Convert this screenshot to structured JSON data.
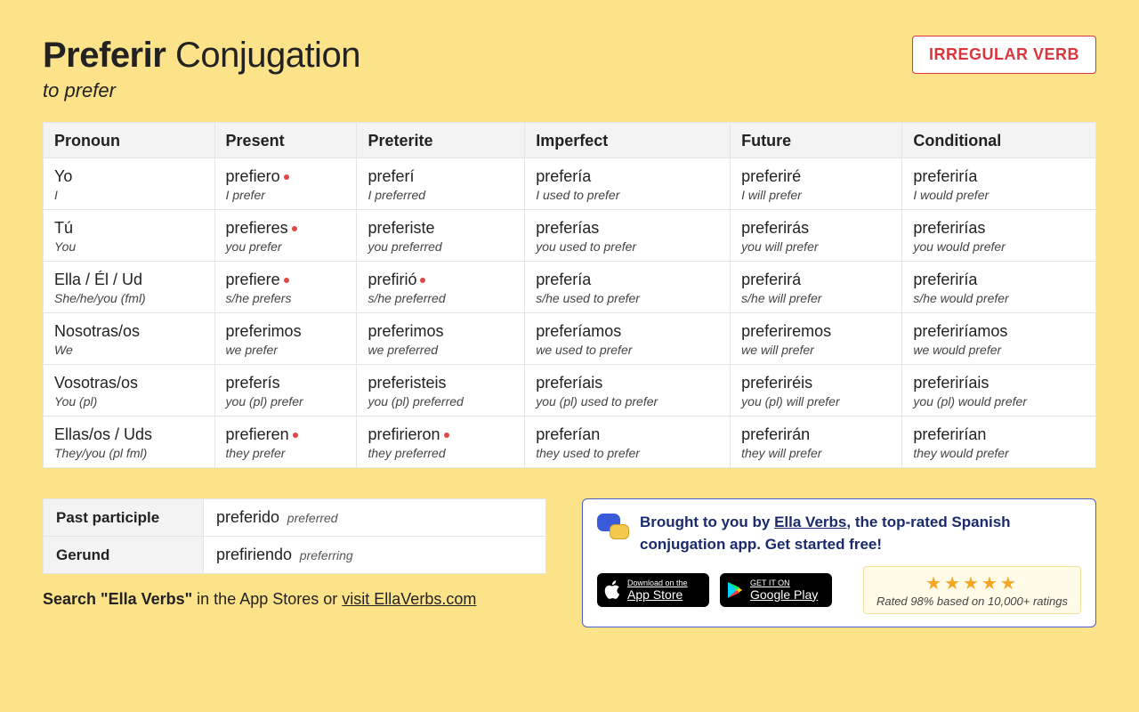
{
  "title_verb": "Preferir",
  "title_rest": "Conjugation",
  "subtitle": "to prefer",
  "badge": "IRREGULAR VERB",
  "headers": [
    "Pronoun",
    "Present",
    "Preterite",
    "Imperfect",
    "Future",
    "Conditional"
  ],
  "rows": [
    {
      "pronoun": {
        "main": "Yo",
        "sub": "I"
      },
      "present": {
        "main": "prefiero",
        "sub": "I prefer",
        "dot": true
      },
      "preterite": {
        "main": "preferí",
        "sub": "I preferred"
      },
      "imperfect": {
        "main": "prefería",
        "sub": "I used to prefer"
      },
      "future": {
        "main": "preferiré",
        "sub": "I will prefer"
      },
      "conditional": {
        "main": "preferiría",
        "sub": "I would prefer"
      }
    },
    {
      "pronoun": {
        "main": "Tú",
        "sub": "You"
      },
      "present": {
        "main": "prefieres",
        "sub": "you prefer",
        "dot": true
      },
      "preterite": {
        "main": "preferiste",
        "sub": "you preferred"
      },
      "imperfect": {
        "main": "preferías",
        "sub": "you used to prefer"
      },
      "future": {
        "main": "preferirás",
        "sub": "you will prefer"
      },
      "conditional": {
        "main": "preferirías",
        "sub": "you would prefer"
      }
    },
    {
      "pronoun": {
        "main": "Ella / Él / Ud",
        "sub": "She/he/you (fml)"
      },
      "present": {
        "main": "prefiere",
        "sub": "s/he prefers",
        "dot": true
      },
      "preterite": {
        "main": "prefirió",
        "sub": "s/he preferred",
        "dot": true
      },
      "imperfect": {
        "main": "prefería",
        "sub": "s/he used to prefer"
      },
      "future": {
        "main": "preferirá",
        "sub": "s/he will prefer"
      },
      "conditional": {
        "main": "preferiría",
        "sub": "s/he would prefer"
      }
    },
    {
      "pronoun": {
        "main": "Nosotras/os",
        "sub": "We"
      },
      "present": {
        "main": "preferimos",
        "sub": "we prefer"
      },
      "preterite": {
        "main": "preferimos",
        "sub": "we preferred"
      },
      "imperfect": {
        "main": "preferíamos",
        "sub": "we used to prefer"
      },
      "future": {
        "main": "preferiremos",
        "sub": "we will prefer"
      },
      "conditional": {
        "main": "preferiríamos",
        "sub": "we would prefer"
      }
    },
    {
      "pronoun": {
        "main": "Vosotras/os",
        "sub": "You (pl)"
      },
      "present": {
        "main": "preferís",
        "sub": "you (pl) prefer"
      },
      "preterite": {
        "main": "preferisteis",
        "sub": "you (pl) preferred"
      },
      "imperfect": {
        "main": "preferíais",
        "sub": "you (pl) used to prefer"
      },
      "future": {
        "main": "preferiréis",
        "sub": "you (pl) will prefer"
      },
      "conditional": {
        "main": "preferiríais",
        "sub": "you (pl) would prefer"
      }
    },
    {
      "pronoun": {
        "main": "Ellas/os / Uds",
        "sub": "They/you (pl fml)"
      },
      "present": {
        "main": "prefieren",
        "sub": "they prefer",
        "dot": true
      },
      "preterite": {
        "main": "prefirieron",
        "sub": "they preferred",
        "dot": true
      },
      "imperfect": {
        "main": "preferían",
        "sub": "they used to prefer"
      },
      "future": {
        "main": "preferirán",
        "sub": "they will prefer"
      },
      "conditional": {
        "main": "preferirían",
        "sub": "they would prefer"
      }
    }
  ],
  "forms": {
    "past_participle": {
      "label": "Past participle",
      "main": "preferido",
      "sub": "preferred"
    },
    "gerund": {
      "label": "Gerund",
      "main": "prefiriendo",
      "sub": "preferring"
    }
  },
  "search_prefix": "Search \"Ella Verbs\"",
  "search_middle": " in the App Stores or ",
  "search_link": "visit EllaVerbs.com",
  "promo": {
    "prefix": "Brought to you by ",
    "brand": "Ella Verbs",
    "suffix": ", the top-rated Spanish conjugation app. Get started free!",
    "appstore_small": "Download on the",
    "appstore_big": "App Store",
    "play_small": "GET IT ON",
    "play_big": "Google Play",
    "rating_text": "Rated 98% based on 10,000+ ratings"
  }
}
